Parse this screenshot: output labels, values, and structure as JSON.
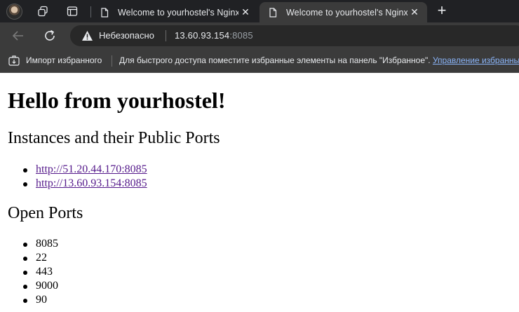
{
  "tabs": [
    {
      "title": "Welcome to yourhostel's Nginx!",
      "active": false,
      "close": "✕"
    },
    {
      "title": "Welcome to yourhostel's Nginx!",
      "active": true,
      "close": "✕"
    }
  ],
  "new_tab": "+",
  "icons": {
    "profile": "profile-avatar",
    "workspaces": "workspaces-icon",
    "tab_actions": "tab-actions-icon",
    "page": "page-icon",
    "back": "back-arrow-icon",
    "reload": "reload-icon",
    "warning": "warning-icon",
    "import": "import-favorites-icon"
  },
  "omnibox": {
    "security_label": "Небезопасно",
    "host": "13.60.93.154",
    "port": ":8085"
  },
  "favorites_bar": {
    "import_label": "Импорт избранного",
    "hint": "Для быстрого доступа поместите избранные элементы на панель \"Избранное\".",
    "manage_link": "Управление избранным"
  },
  "page": {
    "heading": "Hello from yourhostel!",
    "instances_heading": "Instances and their Public Ports",
    "instance_links": [
      "http://51.20.44.170:8085",
      "http://13.60.93.154:8085"
    ],
    "open_ports_heading": "Open Ports",
    "open_ports": [
      "8085",
      "22",
      "443",
      "9000",
      "90"
    ]
  },
  "colors": {
    "chrome_bg": "#202124",
    "toolbar_bg": "#3b3b3b",
    "omnibox_bg": "#282828",
    "visited_link": "#551a8b",
    "manage_link": "#8ab4f8"
  }
}
